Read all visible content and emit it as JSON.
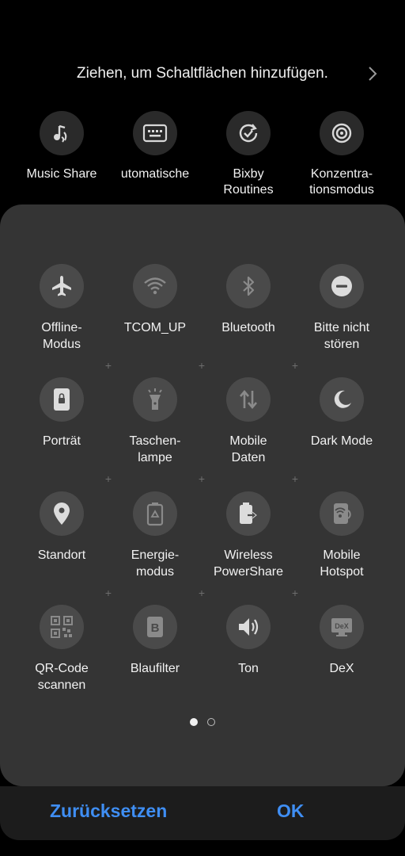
{
  "header": {
    "hint_text": "Ziehen, um Schaltflächen hinzufügen."
  },
  "available_tiles": [
    {
      "label": "Music Share",
      "icon": "music-share-icon"
    },
    {
      "label": "utomatische",
      "icon": "keyboard-icon"
    },
    {
      "label": "Bixby\nRoutines",
      "icon": "routines-icon"
    },
    {
      "label": "Konzentra-\ntionsmodus",
      "icon": "focus-target-icon"
    }
  ],
  "active_tiles": [
    {
      "label": "Offline-\nModus",
      "icon": "airplane-icon"
    },
    {
      "label": "TCOM_UP",
      "icon": "wifi-icon"
    },
    {
      "label": "Bluetooth",
      "icon": "bluetooth-icon"
    },
    {
      "label": "Bitte nicht\nstören",
      "icon": "do-not-disturb-icon"
    },
    {
      "label": "Porträt",
      "icon": "portrait-lock-icon"
    },
    {
      "label": "Taschen-\nlampe",
      "icon": "flashlight-icon"
    },
    {
      "label": "Mobile\nDaten",
      "icon": "mobile-data-icon"
    },
    {
      "label": "Dark Mode",
      "icon": "moon-icon"
    },
    {
      "label": "Standort",
      "icon": "location-pin-icon"
    },
    {
      "label": "Energie-\nmodus",
      "icon": "battery-recycle-icon"
    },
    {
      "label": "Wireless\nPowerShare",
      "icon": "powershare-icon"
    },
    {
      "label": "Mobile\nHotspot",
      "icon": "hotspot-icon"
    },
    {
      "label": "QR-Code\nscannen",
      "icon": "qr-code-icon"
    },
    {
      "label": "Blaufilter",
      "icon": "blue-filter-icon"
    },
    {
      "label": "Ton",
      "icon": "speaker-icon"
    },
    {
      "label": "DeX",
      "icon": "dex-icon"
    }
  ],
  "pagination": {
    "current_page": 1,
    "total_pages": 2
  },
  "footer": {
    "reset_label": "Zurücksetzen",
    "ok_label": "OK"
  },
  "colors": {
    "background": "#000000",
    "panel": "#343434",
    "tile_circle": "#4a4a4a",
    "accent": "#3f8ef3"
  }
}
